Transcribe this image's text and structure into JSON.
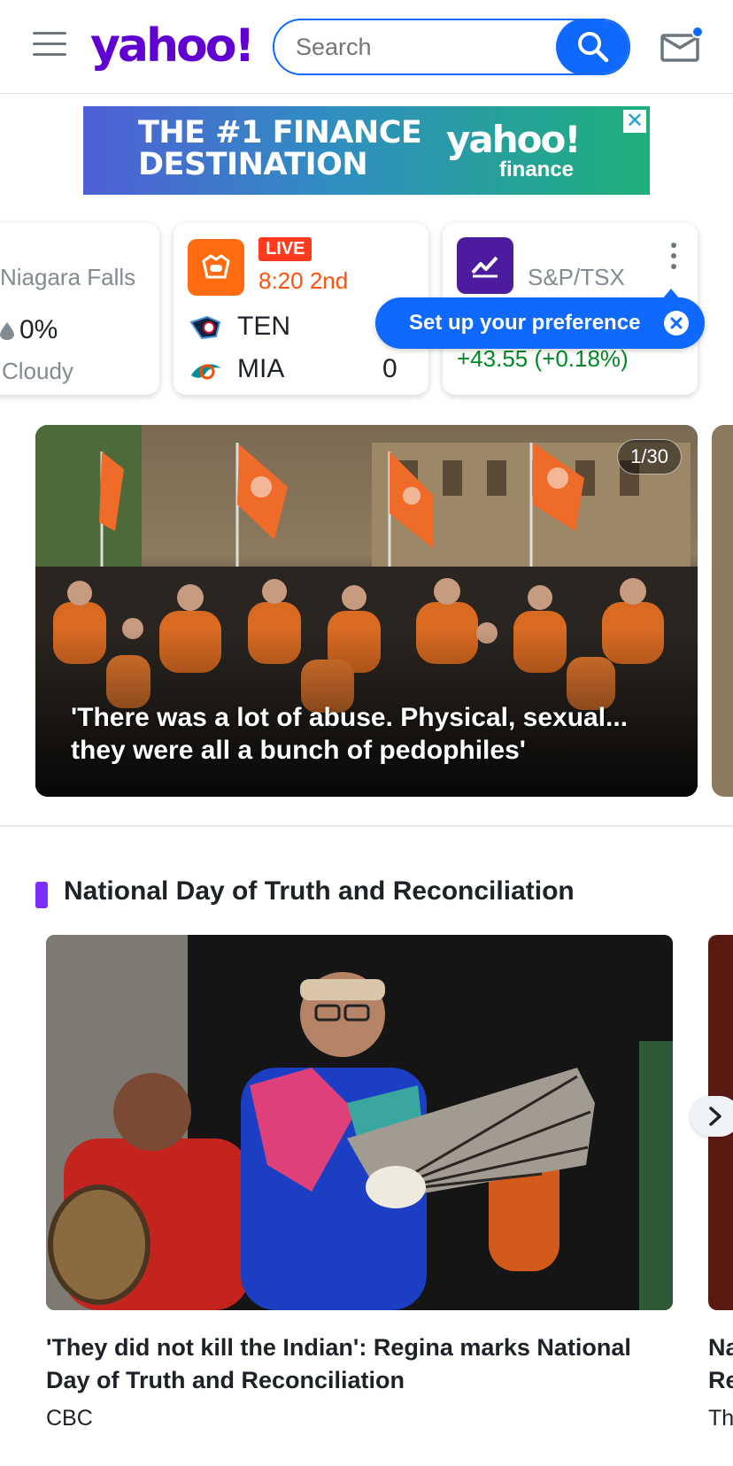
{
  "header": {
    "logo": "yahoo!",
    "search_placeholder": "Search"
  },
  "ad": {
    "headline_line1": "THE #1 FINANCE",
    "headline_line2": "DESTINATION",
    "brand": "yahoo!",
    "brand_sub": "finance",
    "close_label": "✕"
  },
  "weather": {
    "city": "Niagara Falls",
    "precip": "0%",
    "condition": "Cloudy"
  },
  "game": {
    "status": "LIVE",
    "clock": "8:20 2nd",
    "home": {
      "name": "TEN",
      "score": "6"
    },
    "away": {
      "name": "MIA",
      "score": "0"
    }
  },
  "market": {
    "name": "S&P/TSX",
    "change": "+43.55 (+0.18%)"
  },
  "tooltip": {
    "label": "Set up your preference"
  },
  "hero": {
    "counter": "1/30",
    "caption": "'There was a lot of abuse. Physical, sexual... they were all a bunch of pedophiles'"
  },
  "section": {
    "title": "National Day of Truth and Reconciliation",
    "story": {
      "headline": "'They did not kill the Indian': Regina marks National Day of Truth and Reconciliation",
      "source": "CBC"
    },
    "peek": {
      "headline_start": "Na Re",
      "source_start": "Th"
    }
  },
  "colors": {
    "brand": "#6001d2",
    "accent": "#0f69ff",
    "live": "#ff3a1d",
    "positive": "#008a27"
  }
}
